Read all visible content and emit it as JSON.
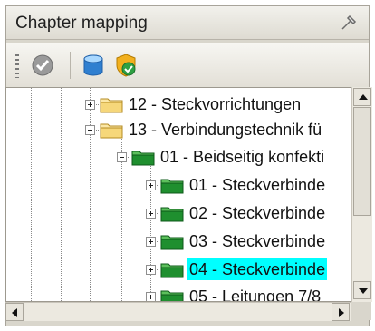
{
  "panel": {
    "title": "Chapter mapping"
  },
  "toolbar": {
    "buttons": [
      {
        "icon": "check-circle-icon",
        "label": ""
      },
      {
        "icon": "database-icon",
        "label": ""
      },
      {
        "icon": "shield-check-icon",
        "label": ""
      }
    ]
  },
  "tree": {
    "nodes": [
      {
        "label": "12 - Steckvorrichtungen",
        "icon": "folder-icon",
        "expander": "plus"
      },
      {
        "label": "13 - Verbindungstechnik fü",
        "icon": "folder-open-icon",
        "expander": "minus"
      },
      {
        "label": "01 - Beidseitig konfekti",
        "icon": "green-folder-icon",
        "expander": "minus"
      },
      {
        "label": "01 - Steckverbinde",
        "icon": "green-folder-icon",
        "expander": "plus"
      },
      {
        "label": "02 - Steckverbinde",
        "icon": "green-folder-icon",
        "expander": "plus"
      },
      {
        "label": "03 - Steckverbinde",
        "icon": "green-folder-icon",
        "expander": "plus"
      },
      {
        "label": "04 - Steckverbinde",
        "icon": "green-folder-icon",
        "expander": "plus",
        "selected": true
      },
      {
        "label": "05 - Leitungen 7/8",
        "icon": "green-folder-icon",
        "expander": "plus"
      }
    ],
    "selected_color": "#00ffff"
  },
  "colors": {
    "panel_bg": "#d9d6cc",
    "tree_bg": "#ffffff",
    "selection": "#00ffff"
  }
}
